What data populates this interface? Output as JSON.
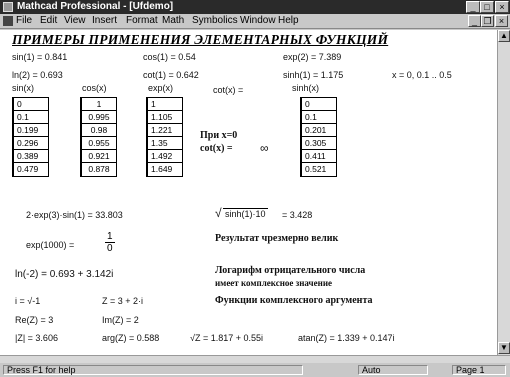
{
  "window": {
    "title": "Mathcad Professional - [Ufdemo]",
    "buttons": {
      "minimize": "_",
      "maximize": "□",
      "close": "×"
    },
    "doc_buttons": {
      "minimize": "_",
      "restore": "❐",
      "close": "×"
    }
  },
  "menu": [
    "File",
    "Edit",
    "View",
    "Insert",
    "Format",
    "Math",
    "Symbolics",
    "Window",
    "Help"
  ],
  "heading": "ПРИМЕРЫ ПРИМЕНЕНИЯ ЭЛЕМЕНТАРНЫХ ФУНКЦИЙ",
  "row1": {
    "sin1": "sin(1) = 0.841",
    "cos1": "cos(1) = 0.54",
    "exp2": "exp(2) = 7.389"
  },
  "row2": {
    "ln2": "ln(2) = 0.693",
    "cot1": "cot(1) = 0.642",
    "sinh1": "sinh(1) = 1.175",
    "xrange": "x = 0, 0.1 .. 0.5"
  },
  "columns": {
    "sin": {
      "header": "sin(x)",
      "values": [
        "0",
        "0.1",
        "0.199",
        "0.296",
        "0.389",
        "0.479"
      ]
    },
    "cos": {
      "header": "cos(x)",
      "values": [
        "1",
        "0.995",
        "0.98",
        "0.955",
        "0.921",
        "0.878"
      ]
    },
    "exp": {
      "header": "exp(x)",
      "values": [
        "1",
        "1.105",
        "1.221",
        "1.35",
        "1.492",
        "1.649"
      ]
    },
    "cot": {
      "header": "cot(x) ="
    },
    "sinh": {
      "header": "sinh(x)",
      "values": [
        "0",
        "0.1",
        "0.201",
        "0.305",
        "0.411",
        "0.521"
      ]
    }
  },
  "note_x0": {
    "line1": "При x=0",
    "line2": "cot(x) =",
    "inf": "∞"
  },
  "expr1": "2·exp(3)·sin(1) = 33.803",
  "expr2_arg": "sinh(1)·10",
  "expr2_val": "= 3.428",
  "overflow": {
    "expr": "exp(1000) =",
    "num": "1",
    "den": "0",
    "message": "Результат чрезмерно велик"
  },
  "ln_neg": {
    "expr": "ln(-2) = 0.693 + 3.142i",
    "message1": "Логарифм отрицательного числа",
    "message2": "имеет комплексное значение"
  },
  "complex_defs": {
    "i": "i = √-1",
    "z": "Z = 3 + 2·i",
    "message": "Функции комплексного аргумента"
  },
  "re_im": {
    "re": "Re(Z) = 3",
    "im": "Im(Z) = 2"
  },
  "last_row": {
    "abs": "|Z| = 3.606",
    "arg": "arg(Z) = 0.588",
    "sqrt": "√Z = 1.817 + 0.55i",
    "atan": "atan(Z) = 1.339 + 0.147i"
  },
  "status": {
    "help": "Press F1 for help",
    "mode": "Auto",
    "page": "Page 1"
  }
}
